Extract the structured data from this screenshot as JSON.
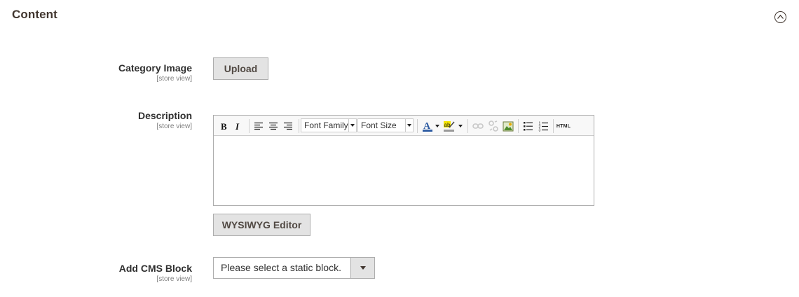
{
  "section": {
    "title": "Content",
    "collapse_icon": "chevron-up-circle-icon"
  },
  "fields": {
    "category_image": {
      "label": "Category Image",
      "scope": "[store view]",
      "button": "Upload"
    },
    "description": {
      "label": "Description",
      "scope": "[store view]",
      "toolbar": {
        "font_family": "Font Family",
        "font_size": "Font Size",
        "html_label": "HTML",
        "icons": [
          "bold-icon",
          "italic-icon",
          "align-left-icon",
          "align-center-icon",
          "align-right-icon",
          "text-color-icon",
          "highlight-color-icon",
          "link-icon",
          "unlink-icon",
          "image-icon",
          "bullet-list-icon",
          "numbered-list-icon",
          "html-source-icon"
        ]
      },
      "editor_content": "",
      "wysiwyg_button": "WYSIWYG Editor"
    },
    "cms_block": {
      "label": "Add CMS Block",
      "scope": "[store view]",
      "selected": "Please select a static block."
    }
  },
  "colors": {
    "text_color": "#2f5da3",
    "highlight": "#f5e500",
    "button_bg": "#e3e3e3",
    "border": "#adadad"
  }
}
